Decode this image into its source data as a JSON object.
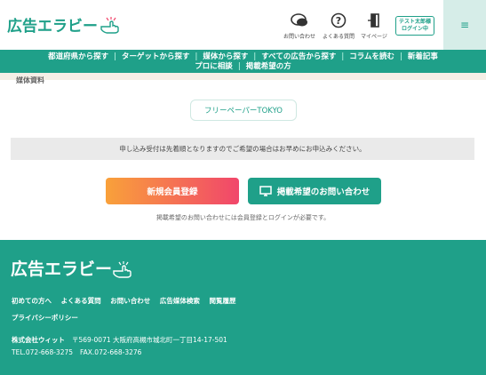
{
  "header": {
    "logo_text": "広告エラビー",
    "contact_label": "お問い合わせ",
    "faq_label": "よくある質問",
    "mypage_label": "マイページ",
    "test_user_line1": "テスト太郎様",
    "test_user_line2": "ログイン中",
    "menu_icon": "≡"
  },
  "nav": {
    "row1": [
      "都道府県から探す",
      "ターゲットから探す",
      "媒体から探す",
      "すべての広告から探す",
      "コラムを読む",
      "新着記事"
    ],
    "row2": [
      "プロに相談",
      "掲載希望の方"
    ]
  },
  "section_label": "媒体資料",
  "media_tag": "フリーペーパーTOKYO",
  "notice": "申し込み受付は先着順となりますのでご希望の場合はお早めにお申込みください。",
  "cta": {
    "register": "新規会員登録",
    "inquiry": "掲載希望のお問い合わせ",
    "note": "掲載希望のお問い合わせには会員登録とログインが必要です。"
  },
  "footer": {
    "logo_text": "広告エラビー",
    "links": [
      "初めての方へ",
      "よくある質問",
      "お問い合わせ",
      "広告媒体検索",
      "閲覧履歴"
    ],
    "privacy": "プライバシーポリシー",
    "company": "株式会社ウィット",
    "address": "〒569-0071 大阪府高槻市城北町一丁目14-17-501",
    "tel": "TEL.072-668-3275",
    "fax": "FAX.072-668-3276"
  },
  "colors": {
    "accent": "#1fa089",
    "gradient_start": "#f9a13a",
    "gradient_end": "#f1466b"
  }
}
